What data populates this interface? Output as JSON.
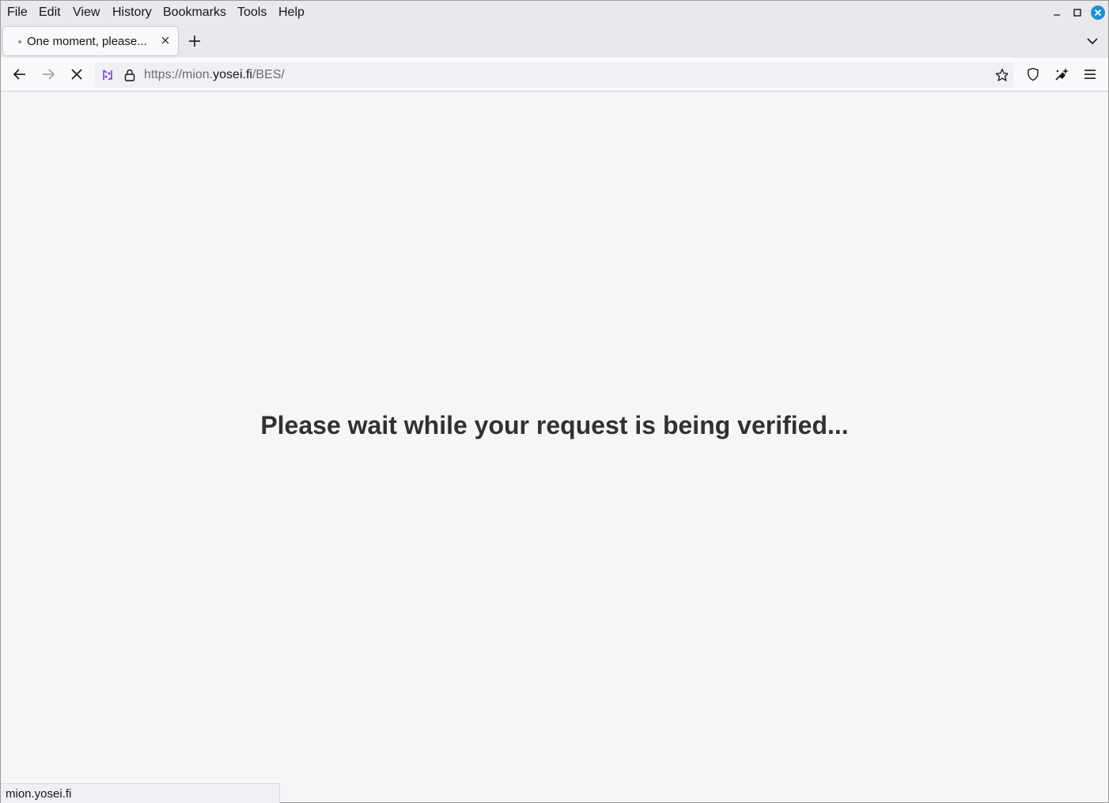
{
  "menubar": {
    "items": [
      {
        "label": "File"
      },
      {
        "label": "Edit"
      },
      {
        "label": "View"
      },
      {
        "label": "History"
      },
      {
        "label": "Bookmarks"
      },
      {
        "label": "Tools"
      },
      {
        "label": "Help"
      }
    ]
  },
  "tabs": {
    "active_title": "One moment, please..."
  },
  "navbar": {
    "url_prefix": "https://mion.",
    "url_host": "yosei.fi",
    "url_path": "/BES/"
  },
  "content": {
    "headline": "Please wait while your request is being verified..."
  },
  "statusbar": {
    "text": "mion.yosei.fi"
  },
  "colors": {
    "close_accent": "#1e90d8",
    "tracking_icon": "#7a3ed8"
  }
}
